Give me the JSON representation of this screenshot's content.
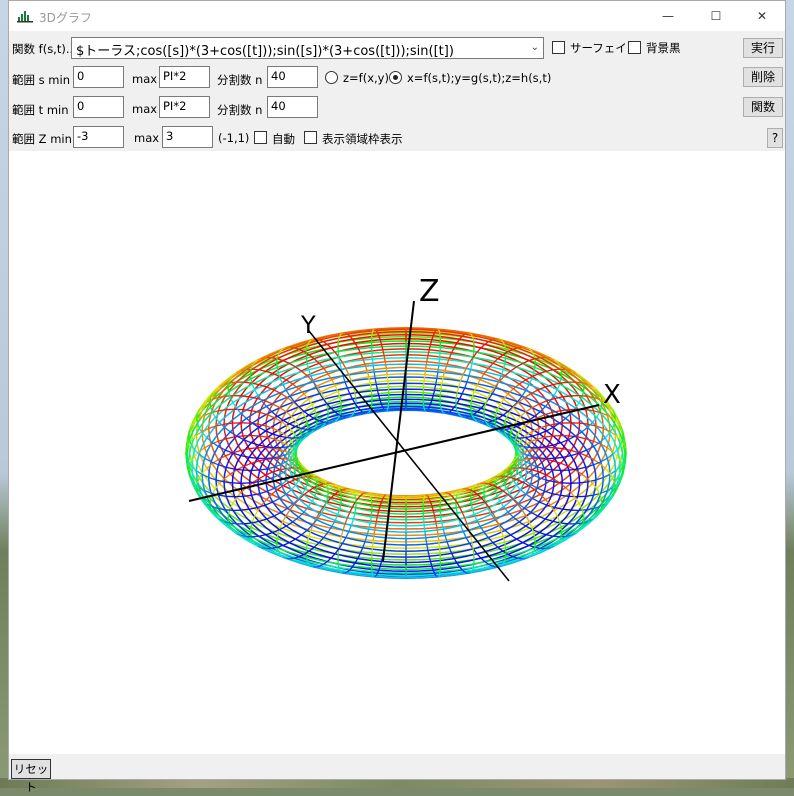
{
  "window": {
    "title": "3Dグラフ",
    "minimize": "—",
    "maximize": "☐",
    "close": "✕"
  },
  "row1": {
    "func_label": "関数 f(s,t)..",
    "func_value": "$トーラス;cos([s])*(3+cos([t]));sin([s])*(3+cos([t]));sin([t])",
    "surface_label": "サーフェイス",
    "bgblack_label": "背景黒",
    "run_button": "実行"
  },
  "row2": {
    "range_label": "範囲 s min",
    "min_value": "0",
    "max_label": "max",
    "max_value": "PI*2",
    "div_label": "分割数 n",
    "div_value": "40",
    "radio1_label": "z=f(x,y)",
    "radio2_label": "x=f(s,t);y=g(s,t);z=h(s,t)",
    "delete_button": "削除"
  },
  "row3": {
    "range_label": "範囲 t min",
    "min_value": "0",
    "max_label": "max",
    "max_value": "PI*2",
    "div_label": "分割数 n",
    "div_value": "40",
    "func_button": "関数"
  },
  "row4": {
    "range_label": "範囲 Z min",
    "min_value": "-3",
    "max_label": "max",
    "max_value": "3",
    "hint": "(-1,1)",
    "auto_label": "自動",
    "frame_label": "表示領域枠表示",
    "help_button": "?"
  },
  "axes": {
    "x": "X",
    "y": "Y",
    "z": "Z"
  },
  "torus": {
    "R": 3,
    "r": 1,
    "s_divisions": 40,
    "t_divisions": 40
  },
  "reset_button": "リセット"
}
